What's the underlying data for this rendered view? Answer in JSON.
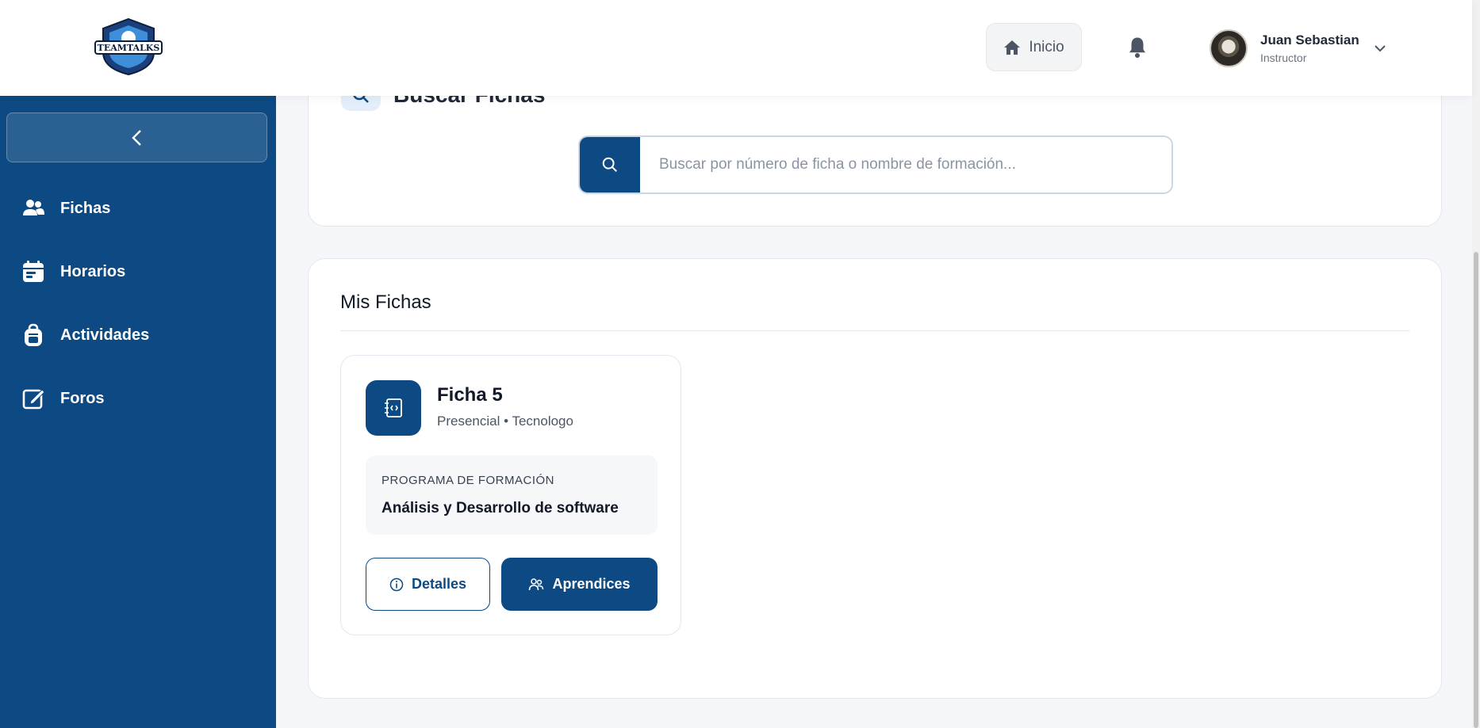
{
  "header": {
    "logo_text": "TEAMTALKS",
    "home_label": "Inicio",
    "user": {
      "name": "Juan Sebastian",
      "role": "Instructor"
    }
  },
  "sidebar": {
    "items": [
      {
        "label": "Fichas",
        "icon": "users-icon"
      },
      {
        "label": "Horarios",
        "icon": "calendar-icon"
      },
      {
        "label": "Actividades",
        "icon": "backpack-icon"
      },
      {
        "label": "Foros",
        "icon": "edit-icon"
      }
    ]
  },
  "search": {
    "title": "Buscar Fichas",
    "placeholder": "Buscar por número de ficha o nombre de formación..."
  },
  "fichas": {
    "section_title": "Mis Fichas",
    "cards": [
      {
        "name": "Ficha 5",
        "meta": "Presencial • Tecnologo",
        "program_label": "PROGRAMA DE FORMACIÓN",
        "program_name": "Análisis y Desarrollo de software",
        "details_label": "Detalles",
        "learners_label": "Aprendices"
      }
    ]
  },
  "colors": {
    "primary": "#0d4a83",
    "background": "#f4f6f9"
  }
}
